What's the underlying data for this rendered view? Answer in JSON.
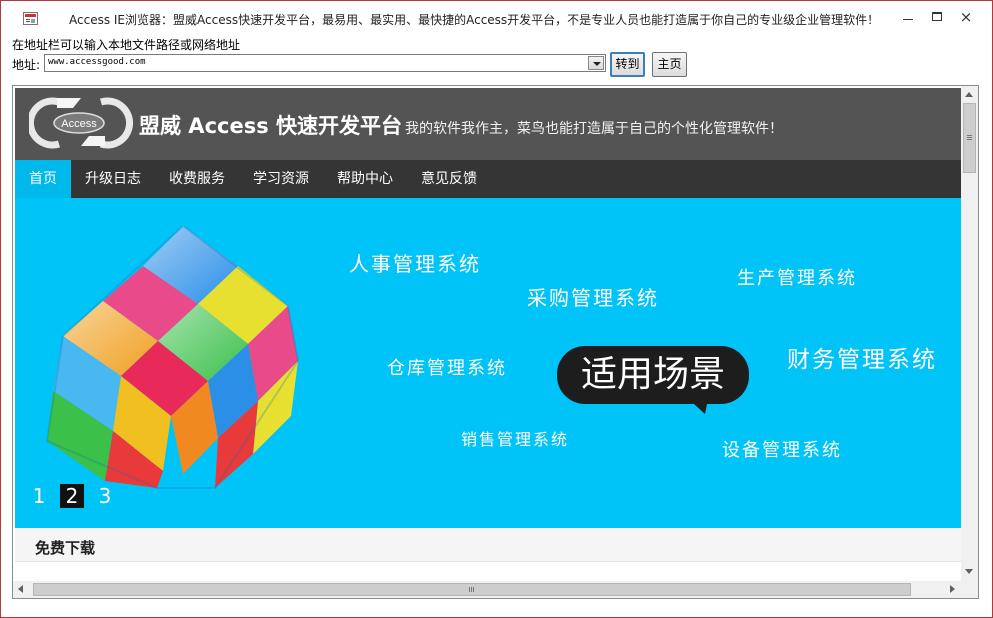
{
  "window": {
    "title": "Access IE浏览器：盟威Access快速开发平台，最易用、最实用、最快捷的Access开发平台，不是专业人员也能打造属于你自己的专业级企业管理软件！",
    "controls": {
      "minimize": "minimize",
      "maximize": "maximize",
      "close": "×"
    }
  },
  "address_bar": {
    "hint": "在地址栏可以输入本地文件路径或网络地址",
    "label": "地址:",
    "value": "www.accessgood.com",
    "go_button": "转到",
    "home_button": "主页"
  },
  "site": {
    "logo_text": "Access",
    "brand": "盟威 Access 快速开发平台",
    "slogan": "我的软件我作主，菜鸟也能打造属于自己的个性化管理软件！",
    "nav": [
      {
        "label": "首页",
        "active": true
      },
      {
        "label": "升级日志",
        "active": false
      },
      {
        "label": "收费服务",
        "active": false
      },
      {
        "label": "学习资源",
        "active": false
      },
      {
        "label": "帮助中心",
        "active": false
      },
      {
        "label": "意见反馈",
        "active": false
      }
    ],
    "banner": {
      "systems": [
        "人事管理系统",
        "采购管理系统",
        "生产管理系统",
        "仓库管理系统",
        "财务管理系统",
        "销售管理系统",
        "设备管理系统"
      ],
      "bubble_text": "适用场景",
      "pager": [
        {
          "label": "1",
          "active": false
        },
        {
          "label": "2",
          "active": true
        },
        {
          "label": "3",
          "active": false
        }
      ]
    },
    "section_title": "免费下载"
  },
  "colors": {
    "banner_bg": "#00c3f7",
    "nav_active": "#00b9ec",
    "header_bg": "#545454",
    "nav_bg": "#353535"
  }
}
